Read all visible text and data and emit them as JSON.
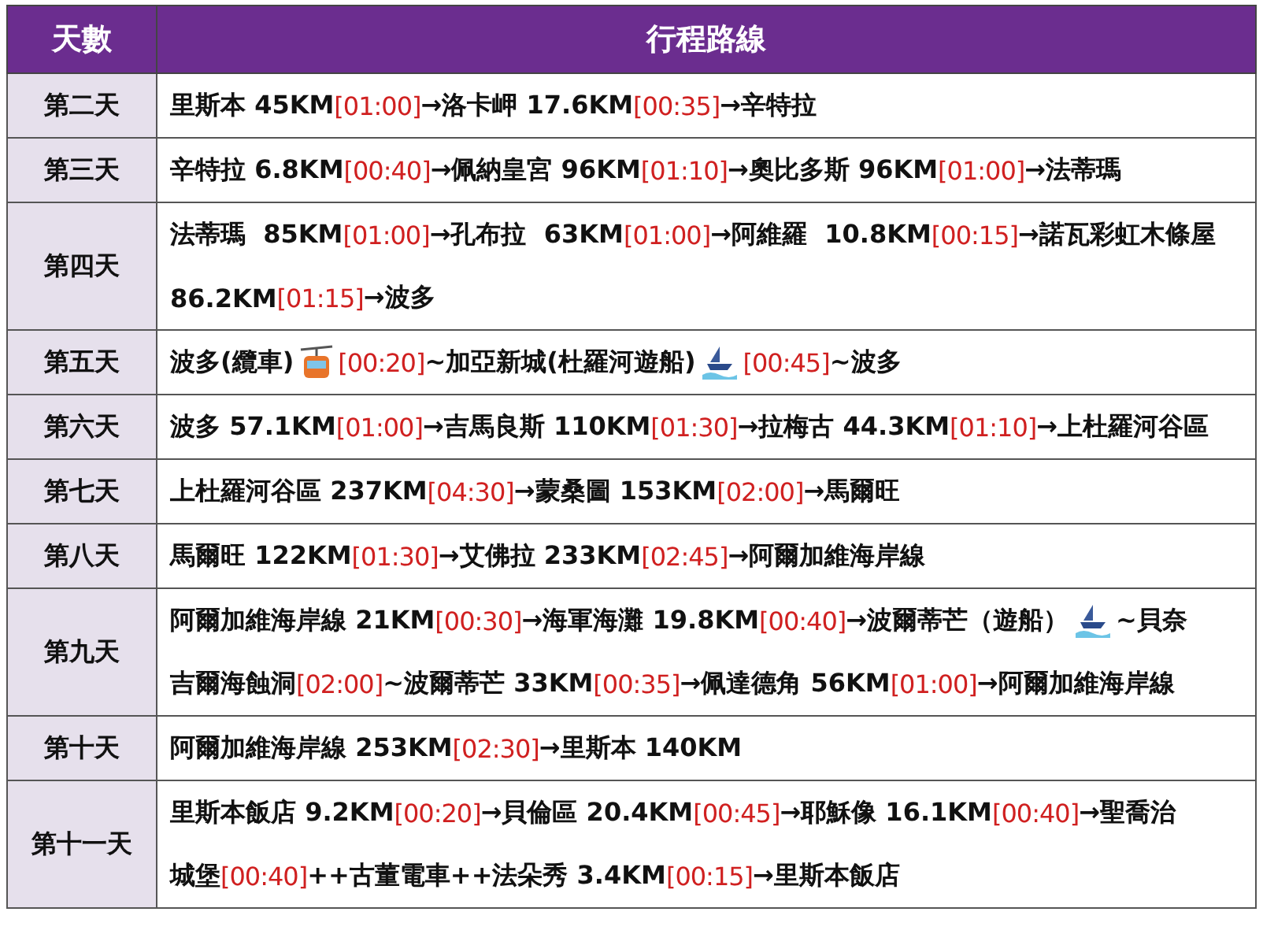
{
  "table": {
    "columns": [
      "天數",
      "行程路線"
    ],
    "rows": [
      {
        "day": "第二天",
        "lines": [
          [
            {
              "kind": "place",
              "text": "里斯本 45KM"
            },
            {
              "kind": "time",
              "text": "[01:00]"
            },
            {
              "kind": "place",
              "text": "→洛卡岬 17.6KM"
            },
            {
              "kind": "time",
              "text": "[00:35]"
            },
            {
              "kind": "place",
              "text": "→辛特拉"
            }
          ]
        ]
      },
      {
        "day": "第三天",
        "lines": [
          [
            {
              "kind": "place",
              "text": "辛特拉 6.8KM"
            },
            {
              "kind": "time",
              "text": "[00:40]"
            },
            {
              "kind": "place",
              "text": "→佩納皇宮 96KM"
            },
            {
              "kind": "time",
              "text": "[01:10]"
            },
            {
              "kind": "place",
              "text": "→奧比多斯 96KM"
            },
            {
              "kind": "time",
              "text": "[01:00]"
            },
            {
              "kind": "place",
              "text": "→法蒂瑪"
            }
          ]
        ]
      },
      {
        "day": "第四天",
        "lines": [
          [
            {
              "kind": "place",
              "text": "法蒂瑪  85KM"
            },
            {
              "kind": "time",
              "text": "[01:00]"
            },
            {
              "kind": "place",
              "text": "→孔布拉  63KM"
            },
            {
              "kind": "time",
              "text": "[01:00]"
            },
            {
              "kind": "place",
              "text": "→阿維羅  10.8KM"
            },
            {
              "kind": "time",
              "text": "[00:15]"
            },
            {
              "kind": "place",
              "text": "→諾瓦彩虹木條屋"
            }
          ],
          [
            {
              "kind": "place",
              "text": "86.2KM"
            },
            {
              "kind": "time",
              "text": "[01:15]"
            },
            {
              "kind": "place",
              "text": "→波多"
            }
          ]
        ]
      },
      {
        "day": "第五天",
        "lines": [
          [
            {
              "kind": "place",
              "text": "波多(纜車)"
            },
            {
              "kind": "gondola"
            },
            {
              "kind": "time",
              "text": "[00:20]"
            },
            {
              "kind": "place",
              "text": "~加亞新城(杜羅河遊船)"
            },
            {
              "kind": "boat"
            },
            {
              "kind": "time",
              "text": "[00:45]"
            },
            {
              "kind": "place",
              "text": "~波多"
            }
          ]
        ]
      },
      {
        "day": "第六天",
        "lines": [
          [
            {
              "kind": "place",
              "text": "波多 57.1KM"
            },
            {
              "kind": "time",
              "text": "[01:00]"
            },
            {
              "kind": "place",
              "text": "→吉馬良斯 110KM"
            },
            {
              "kind": "time",
              "text": "[01:30]"
            },
            {
              "kind": "place",
              "text": "→拉梅古 44.3KM"
            },
            {
              "kind": "time",
              "text": "[01:10]"
            },
            {
              "kind": "place",
              "text": "→上杜羅河谷區"
            }
          ]
        ]
      },
      {
        "day": "第七天",
        "lines": [
          [
            {
              "kind": "place",
              "text": "上杜羅河谷區 237KM"
            },
            {
              "kind": "time",
              "text": "[04:30]"
            },
            {
              "kind": "place",
              "text": "→蒙桑圖 153KM"
            },
            {
              "kind": "time",
              "text": "[02:00]"
            },
            {
              "kind": "place",
              "text": "→馬爾旺"
            }
          ]
        ]
      },
      {
        "day": "第八天",
        "lines": [
          [
            {
              "kind": "place",
              "text": "馬爾旺 122KM"
            },
            {
              "kind": "time",
              "text": "[01:30]"
            },
            {
              "kind": "place",
              "text": "→艾佛拉 233KM"
            },
            {
              "kind": "time",
              "text": "[02:45]"
            },
            {
              "kind": "place",
              "text": "→阿爾加維海岸線"
            }
          ]
        ]
      },
      {
        "day": "第九天",
        "lines": [
          [
            {
              "kind": "place",
              "text": "阿爾加維海岸線 21KM"
            },
            {
              "kind": "time",
              "text": "[00:30]"
            },
            {
              "kind": "place",
              "text": "→海軍海灘 19.8KM"
            },
            {
              "kind": "time",
              "text": "[00:40]"
            },
            {
              "kind": "place",
              "text": "→波爾蒂芒（遊船）"
            },
            {
              "kind": "boat"
            },
            {
              "kind": "place",
              "text": "~貝奈"
            }
          ],
          [
            {
              "kind": "place",
              "text": "吉爾海蝕洞"
            },
            {
              "kind": "time",
              "text": "[02:00]"
            },
            {
              "kind": "place",
              "text": "~波爾蒂芒 33KM"
            },
            {
              "kind": "time",
              "text": "[00:35]"
            },
            {
              "kind": "place",
              "text": "→佩達德角 56KM"
            },
            {
              "kind": "time",
              "text": "[01:00]"
            },
            {
              "kind": "place",
              "text": "→阿爾加維海岸線"
            }
          ]
        ]
      },
      {
        "day": "第十天",
        "lines": [
          [
            {
              "kind": "place",
              "text": "阿爾加維海岸線 253KM"
            },
            {
              "kind": "time",
              "text": "[02:30]"
            },
            {
              "kind": "place",
              "text": "→里斯本 140KM"
            }
          ]
        ]
      },
      {
        "day": "第十一天",
        "lines": [
          [
            {
              "kind": "place",
              "text": "里斯本飯店 9.2KM"
            },
            {
              "kind": "time",
              "text": "[00:20]"
            },
            {
              "kind": "place",
              "text": "→貝倫區 20.4KM"
            },
            {
              "kind": "time",
              "text": "[00:45]"
            },
            {
              "kind": "place",
              "text": "→耶穌像 16.1KM"
            },
            {
              "kind": "time",
              "text": "[00:40]"
            },
            {
              "kind": "place",
              "text": "→聖喬治"
            }
          ],
          [
            {
              "kind": "place",
              "text": "城堡"
            },
            {
              "kind": "time",
              "text": "[00:40]"
            },
            {
              "kind": "place",
              "text": "++古董電車++法朵秀 3.4KM"
            },
            {
              "kind": "time",
              "text": "[00:15]"
            },
            {
              "kind": "place",
              "text": "→里斯本飯店"
            }
          ]
        ]
      }
    ]
  }
}
